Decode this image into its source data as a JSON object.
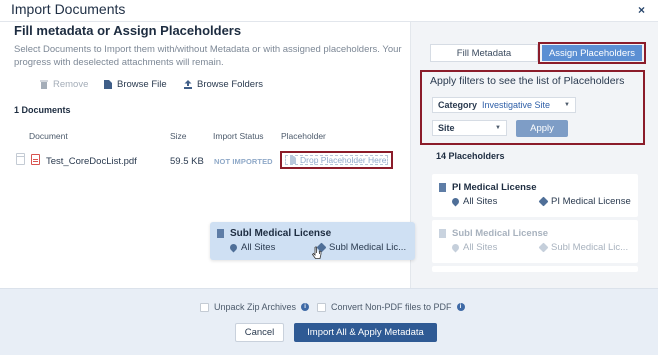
{
  "header": {
    "title": "Import Documents",
    "close_icon": "×"
  },
  "left": {
    "title": "Fill metadata or Assign Placeholders",
    "description": "Select Documents to Import them with/without Metadata or with assigned placeholders. Your progress with deselected attachments will remain.",
    "toolbar": {
      "remove": "Remove",
      "browse_file": "Browse File",
      "browse_folders": "Browse Folders"
    },
    "doc_count": "1 Documents",
    "table": {
      "headers": {
        "document": "Document",
        "size": "Size",
        "status": "Import Status",
        "placeholder": "Placeholder"
      },
      "rows": [
        {
          "name": "Test_CoreDocList.pdf",
          "size": "59.5 KB",
          "status": "NOT IMPORTED",
          "placeholder": "Drop Placeholder Here"
        }
      ]
    },
    "dragging": {
      "title": "Subl Medical License",
      "site": "All Sites",
      "tag": "Subl Medical Lic..."
    }
  },
  "right": {
    "tabs": {
      "fill": "Fill Metadata",
      "assign": "Assign Placeholders"
    },
    "filter": {
      "title": "Apply filters to see the list of Placeholders",
      "category_label": "Category",
      "category_value": "Investigative Site",
      "site_value": "Site",
      "apply": "Apply"
    },
    "count": "14 Placeholders",
    "placeholders": [
      {
        "title": "PI Medical License",
        "site": "All Sites",
        "tag": "PI Medical License"
      },
      {
        "title": "Subl Medical License",
        "site": "All Sites",
        "tag": "Subl Medical Lic..."
      }
    ]
  },
  "footer": {
    "unpack": "Unpack Zip Archives",
    "convert": "Convert Non-PDF files to PDF",
    "cancel": "Cancel",
    "import": "Import All & Apply Metadata"
  },
  "colors": {
    "accent": "#2f5a94",
    "tab_active": "#5b8fd3",
    "highlight_border": "#8b1c2a",
    "footer_bg": "#e8eef6"
  }
}
